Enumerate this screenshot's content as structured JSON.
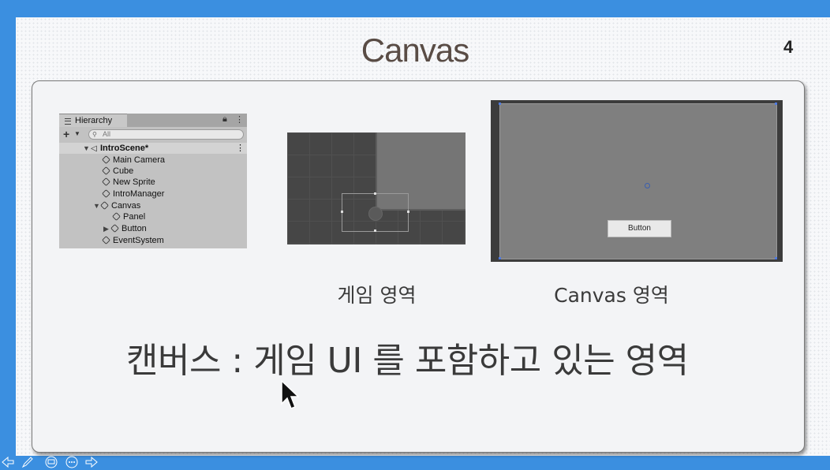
{
  "slide": {
    "title": "Canvas",
    "page_number": "4",
    "caption_game": "게임 영역",
    "caption_canvas": "Canvas 영역",
    "main_text": "캔버스 : 게임 UI 를 포함하고 있는 영역"
  },
  "hierarchy": {
    "tab_label": "Hierarchy",
    "search_placeholder": "All",
    "scene": "IntroScene*",
    "items": [
      "Main Camera",
      "Cube",
      "New Sprite",
      "IntroManager",
      "Canvas",
      "Panel",
      "Button",
      "EventSystem"
    ]
  },
  "canvas_view": {
    "button_label": "Button"
  },
  "colors": {
    "frame": "#3b8fe0",
    "title": "#594c45",
    "text": "#3a3a3a"
  },
  "icons": [
    "menu-icon",
    "lock-icon",
    "kebab-icon",
    "plus-icon",
    "search-icon",
    "cube-icon",
    "nav-prev-icon",
    "pen-icon",
    "screen-icon",
    "more-icon",
    "nav-next-icon",
    "mouse-cursor-icon"
  ]
}
